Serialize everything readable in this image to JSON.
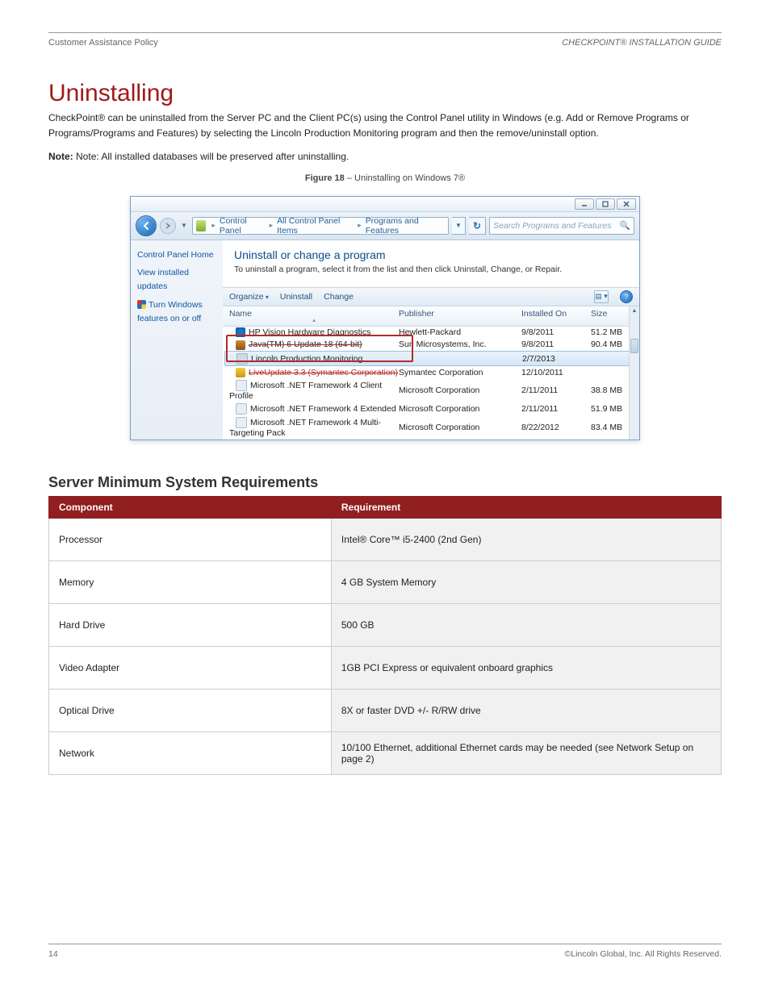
{
  "header": {
    "left": "Customer Assistance Policy",
    "right": "CHECKPOINT® INSTALLATION GUIDE"
  },
  "section": {
    "heading": "Uninstalling",
    "paragraphs": [
      "CheckPoint® can be uninstalled from the Server PC and the Client PC(s) using the Control Panel utility in Windows",
      "(e.g. Add or Remove Programs or Programs/Programs and Features) by selecting the Lincoln Production Monitoring program and then the remove/uninstall option.",
      "Note: All installed databases will be preserved after uninstalling."
    ],
    "bold_prefix": "Note:"
  },
  "figure": {
    "bold": "Figure 18",
    "rest": " – Uninstalling on Windows 7®"
  },
  "screenshot": {
    "breadcrumbs": [
      "Control Panel",
      "All Control Panel Items",
      "Programs and Features"
    ],
    "search_placeholder": "Search Programs and Features",
    "leftnav": {
      "home": "Control Panel Home",
      "updates": "View installed updates",
      "features": "Turn Windows features on or off"
    },
    "title": "Uninstall or change a program",
    "subtitle": "To uninstall a program, select it from the list and then click Uninstall, Change, or Repair.",
    "toolbar": {
      "organize": "Organize",
      "uninstall": "Uninstall",
      "change": "Change"
    },
    "columns": {
      "name": "Name",
      "publisher": "Publisher",
      "installed": "Installed On",
      "size": "Size"
    },
    "rows": [
      {
        "name": "HP Vision Hardware Diagnostics",
        "pub": "Hewlett-Packard",
        "date": "9/8/2011",
        "size": "51.2 MB",
        "icon": "ico-hp"
      },
      {
        "name": "Java(TM) 6 Update 18 (64-bit)",
        "pub": "Sun Microsystems, Inc.",
        "date": "9/8/2011",
        "size": "90.4 MB",
        "icon": "ico-java",
        "strike": true
      },
      {
        "name": "Lincoln Production Monitoring",
        "pub": "",
        "date": "2/7/2013",
        "size": "",
        "icon": "ico-gen",
        "selected": true
      },
      {
        "name": "LiveUpdate 3.3 (Symantec Corporation)",
        "pub": "Symantec Corporation",
        "date": "12/10/2011",
        "size": "",
        "icon": "ico-sym",
        "strike": true,
        "red": true
      },
      {
        "name": "Microsoft .NET Framework 4 Client Profile",
        "pub": "Microsoft Corporation",
        "date": "2/11/2011",
        "size": "38.8 MB",
        "icon": "ico-net"
      },
      {
        "name": "Microsoft .NET Framework 4 Extended",
        "pub": "Microsoft Corporation",
        "date": "2/11/2011",
        "size": "51.9 MB",
        "icon": "ico-net"
      },
      {
        "name": "Microsoft .NET Framework 4 Multi-Targeting Pack",
        "pub": "Microsoft Corporation",
        "date": "8/22/2012",
        "size": "83.4 MB",
        "icon": "ico-net"
      }
    ]
  },
  "spec": {
    "heading": "Server Minimum System Requirements",
    "columns": {
      "component": "Component",
      "requirement": "Requirement"
    },
    "rows": [
      {
        "k": "Processor",
        "v": "Intel® Core™ i5-2400 (2nd Gen)"
      },
      {
        "k": "Memory",
        "v": "4 GB System Memory"
      },
      {
        "k": "Hard Drive",
        "v": "500 GB"
      },
      {
        "k": "Video Adapter",
        "v": "1GB PCI Express or equivalent onboard graphics"
      },
      {
        "k": "Optical Drive",
        "v": "8X or faster DVD +/- R/RW drive"
      },
      {
        "k": "Network",
        "v": "10/100 Ethernet,  additional Ethernet cards may be needed (see Network Setup on page 2)"
      }
    ]
  },
  "footer": {
    "left": "14",
    "right": "©Lincoln Global, Inc.  All Rights Reserved."
  }
}
